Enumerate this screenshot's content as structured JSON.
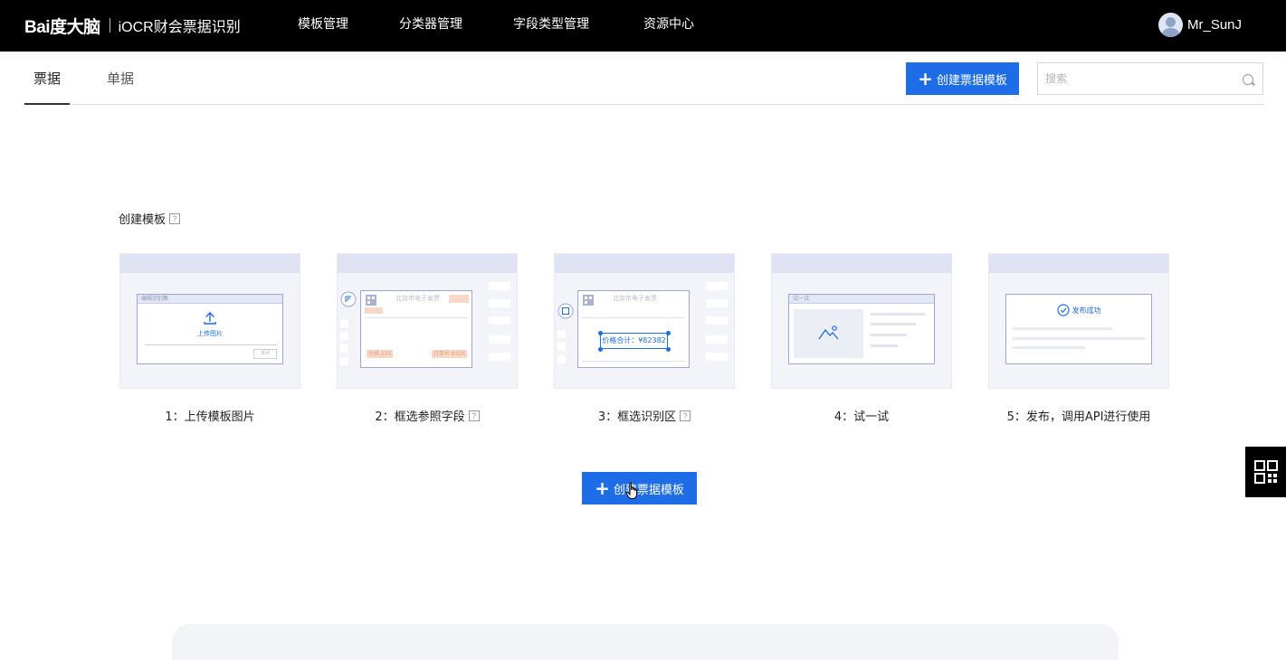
{
  "header": {
    "brand_baidu": "Bai度大脑",
    "brand_product": "iOCR财会票据识别",
    "nav": [
      {
        "label": "模板管理"
      },
      {
        "label": "分类器管理"
      },
      {
        "label": "字段类型管理"
      },
      {
        "label": "资源中心"
      }
    ],
    "username": "Mr_SunJ"
  },
  "tabs": [
    {
      "label": "票据",
      "active": true
    },
    {
      "label": "单据",
      "active": false
    }
  ],
  "toolbar": {
    "create_label": "创建票据模板",
    "search_placeholder": "搜索"
  },
  "section": {
    "title": "创建模板",
    "help_glyph": "?"
  },
  "steps": [
    {
      "label": "1：上传模板图片",
      "help": false,
      "mini": {
        "window_title": "编辑识别集",
        "upload_text": "上传图片",
        "close_text": "关闭"
      }
    },
    {
      "label": "2：框选参照字段",
      "help": true,
      "mini": {
        "doc_title": "北京市电子发票",
        "price_tag": "价格 225",
        "order_tag": "订单号 8326"
      }
    },
    {
      "label": "3：框选识别区",
      "help": true,
      "mini": {
        "doc_title": "北京市电子发票",
        "selection_text": "价格合计：¥82382"
      }
    },
    {
      "label": "4：试一试",
      "help": false,
      "mini": {
        "window_title": "试一试"
      }
    },
    {
      "label": "5：发布，调用API进行使用",
      "help": false,
      "mini": {
        "success_text": "发布成功"
      }
    }
  ],
  "center_button": {
    "label": "创建票据模板"
  },
  "colors": {
    "primary": "#1e6de6",
    "topbar": "#000000",
    "card_bg": "#f3f4fa",
    "card_head": "#dfe2f3"
  }
}
